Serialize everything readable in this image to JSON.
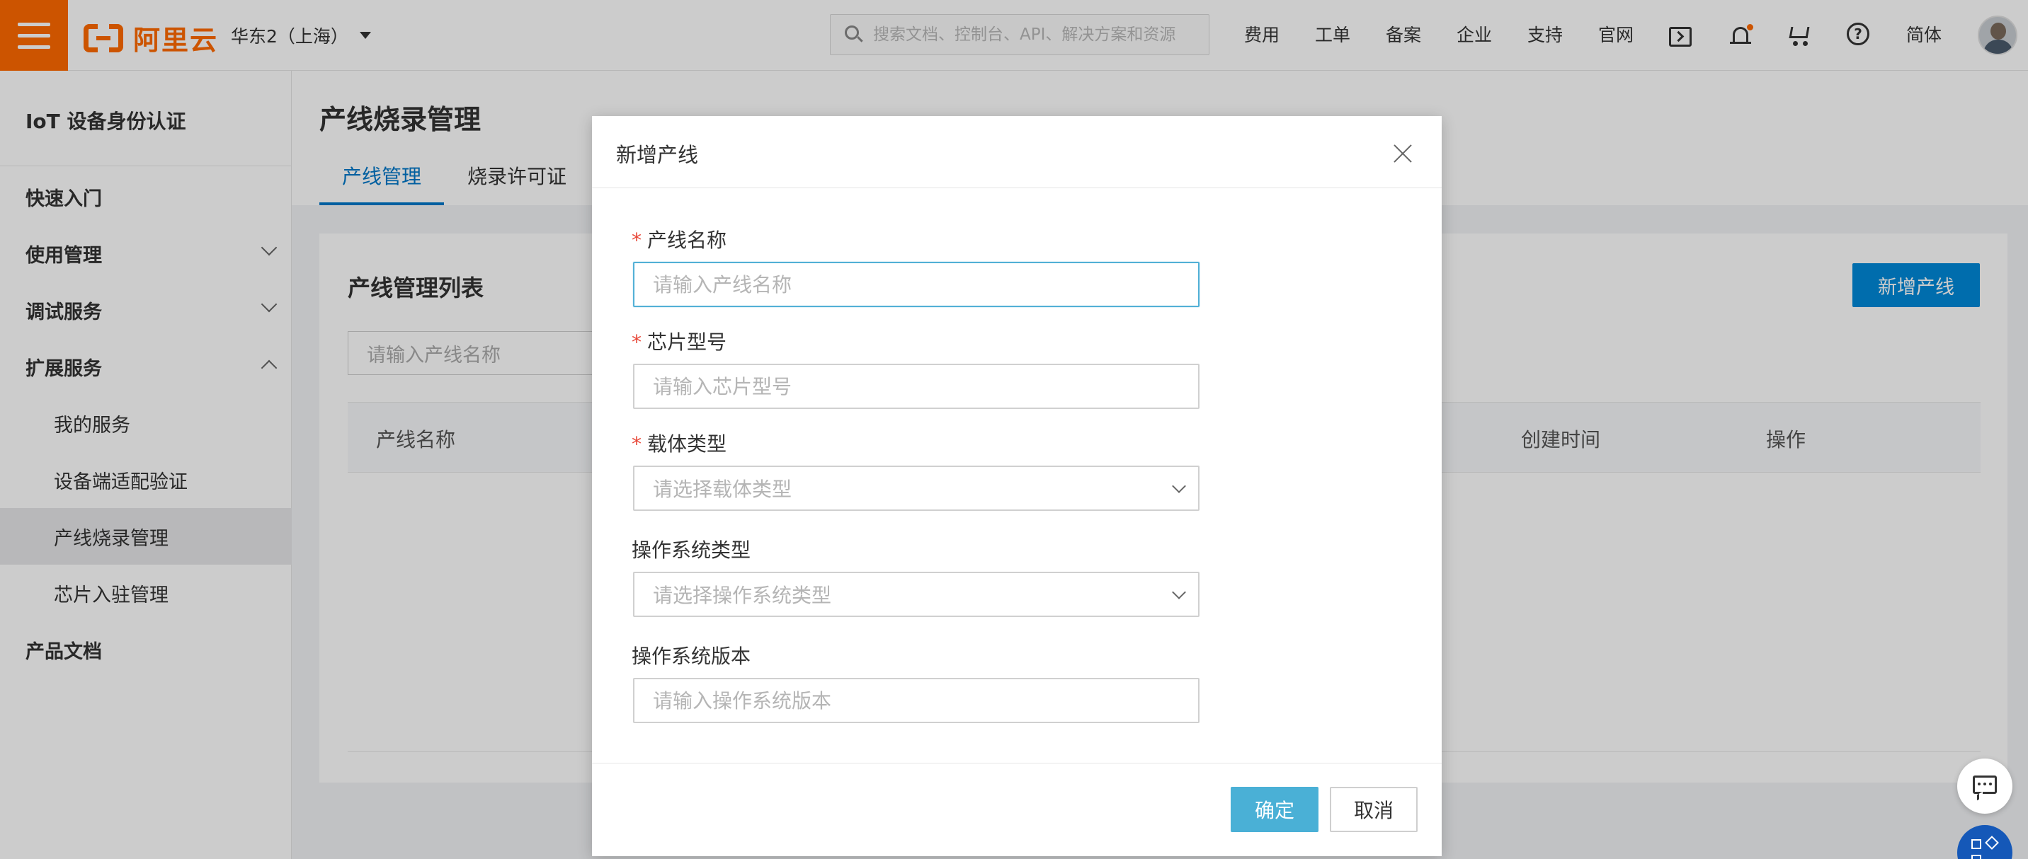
{
  "header": {
    "logo_text": "阿里云",
    "region": "华东2（上海）",
    "search_placeholder": "搜索文档、控制台、API、解决方案和资源",
    "nav_links": [
      "费用",
      "工单",
      "备案",
      "企业",
      "支持",
      "官网"
    ],
    "language": "简体",
    "brand_color": "#ff6a00"
  },
  "sidebar": {
    "title": "IoT 设备身份认证",
    "items": [
      {
        "label": "快速入门"
      },
      {
        "label": "使用管理"
      },
      {
        "label": "调试服务"
      },
      {
        "label": "扩展服务"
      },
      {
        "label": "我的服务"
      },
      {
        "label": "设备端适配验证"
      },
      {
        "label": "产线烧录管理"
      },
      {
        "label": "芯片入驻管理"
      },
      {
        "label": "产品文档"
      }
    ]
  },
  "main": {
    "title": "产线烧录管理",
    "tabs": [
      {
        "label": "产线管理"
      },
      {
        "label": "烧录许可证"
      }
    ],
    "list_title": "产线管理列表",
    "add_button": "新增产线",
    "search_placeholder": "请输入产线名称",
    "columns": [
      "产线名称",
      "创建时间",
      "操作"
    ]
  },
  "modal": {
    "title": "新增产线",
    "fields": [
      {
        "label": "产线名称",
        "required": "*",
        "placeholder": "请输入产线名称"
      },
      {
        "label": "芯片型号",
        "required": "*",
        "placeholder": "请输入芯片型号"
      },
      {
        "label": "载体类型",
        "required": "*",
        "placeholder": "请选择载体类型"
      },
      {
        "label": "操作系统类型",
        "placeholder": "请选择操作系统类型"
      },
      {
        "label": "操作系统版本",
        "placeholder": "请输入操作系统版本"
      }
    ],
    "ok_button": "确定",
    "cancel_button": "取消",
    "accent_color": "#4ab0d6"
  }
}
